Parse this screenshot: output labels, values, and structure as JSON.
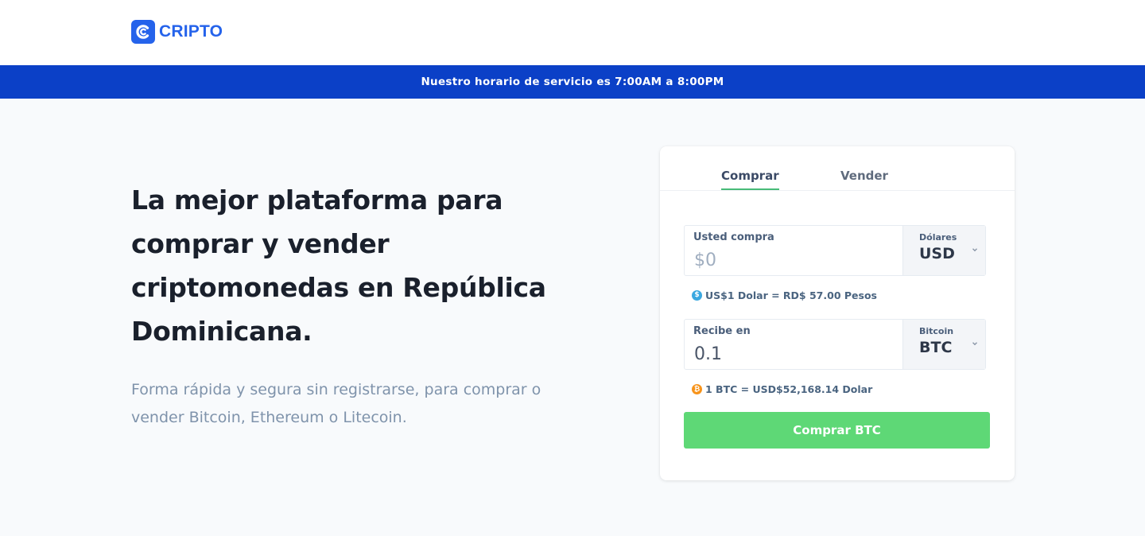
{
  "brand": {
    "name": "CRIPTO",
    "color": "#2563eb"
  },
  "banner": {
    "text": "Nuestro horario de servicio es 7:00AM a 8:00PM",
    "color": "#0b40c7"
  },
  "hero": {
    "title": "La mejor plataforma para comprar y vender criptomonedas en República Dominicana.",
    "subtitle": "Forma rápida y segura sin registrarse, para comprar o vender Bitcoin, Ethereum o Litecoin."
  },
  "widget": {
    "tabs": [
      {
        "label": "Comprar",
        "active": true
      },
      {
        "label": "Vender",
        "active": false
      }
    ],
    "buy_field": {
      "label": "Usted compra",
      "placeholder": "$0",
      "currency_label": "Dólares",
      "currency_code": "USD"
    },
    "usd_rate": "US$1 Dolar = RD$ 57.00 Pesos",
    "receive_field": {
      "label": "Recibe en",
      "value": "0.1",
      "currency_label": "Bitcoin",
      "currency_code": "BTC"
    },
    "btc_rate": "1 BTC = USD$52,168.14 Dolar",
    "submit_label": "Comprar BTC",
    "accent_color": "#5ed876",
    "icons": [
      "dollar-coin-icon",
      "bitcoin-icon",
      "chevron-down-icon"
    ]
  }
}
